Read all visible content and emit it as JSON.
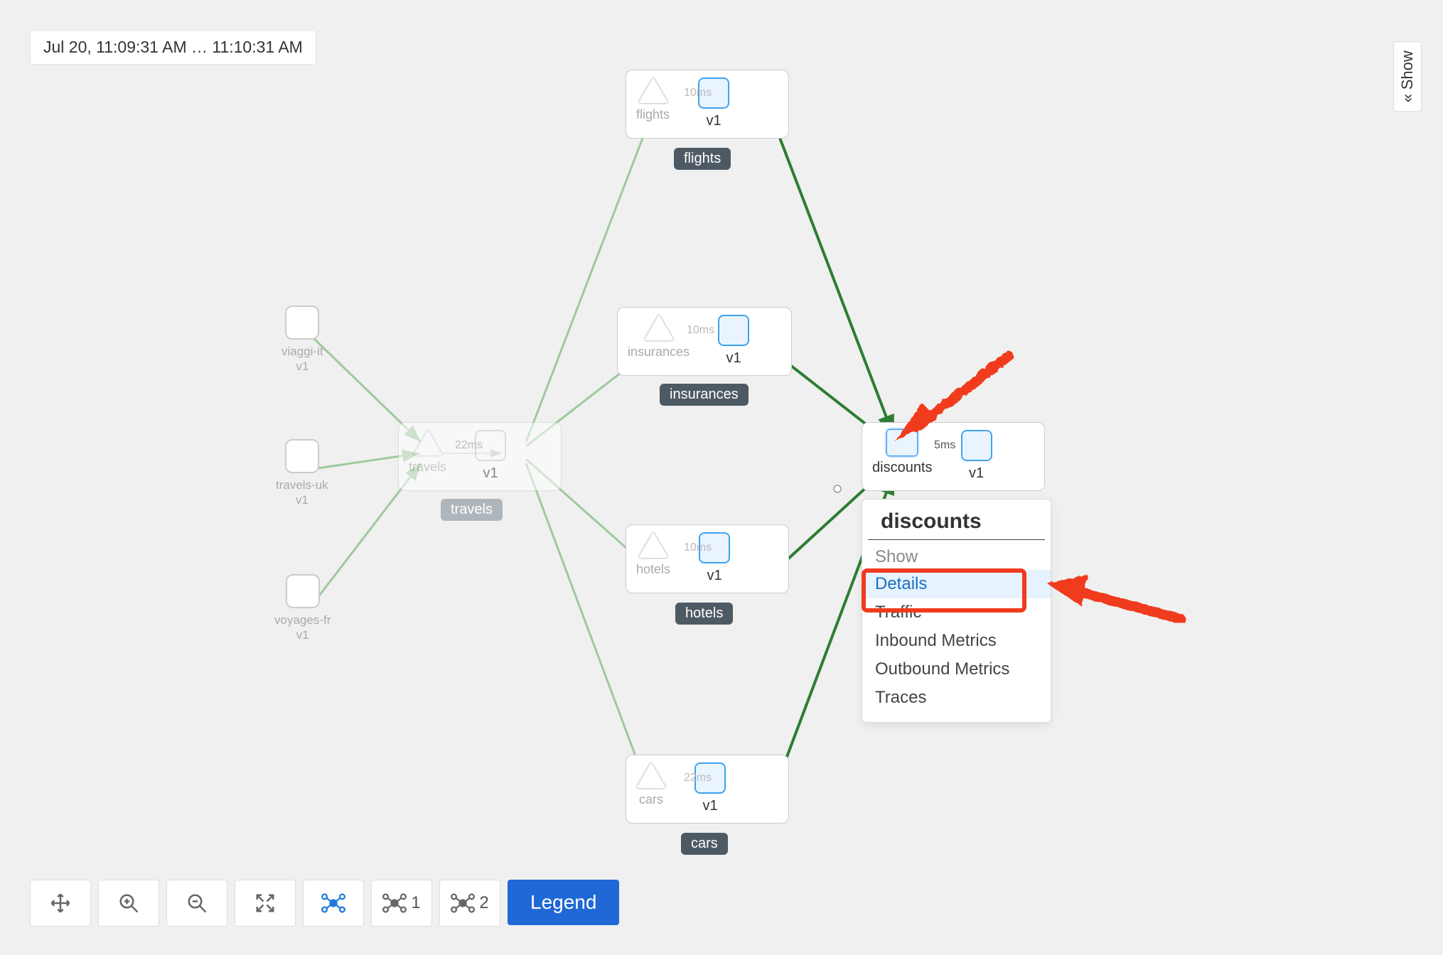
{
  "timestamp": "Jul 20, 11:09:31 AM … 11:10:31 AM",
  "show_panel_label": "Show",
  "legend_button": "Legend",
  "toolbar": {
    "layout1_suffix": "1",
    "layout2_suffix": "2"
  },
  "origins": [
    {
      "label": "viaggi-it\nv1"
    },
    {
      "label": "travels-uk\nv1"
    },
    {
      "label": "voyages-fr\nv1"
    }
  ],
  "travels": {
    "service": "travels",
    "version": "v1",
    "latency": "22ms",
    "group": "travels"
  },
  "services": [
    {
      "name": "flights",
      "version": "v1",
      "latency": "10ms",
      "group": "flights"
    },
    {
      "name": "insurances",
      "version": "v1",
      "latency": "10ms",
      "group": "insurances"
    },
    {
      "name": "hotels",
      "version": "v1",
      "latency": "10ms",
      "group": "hotels"
    },
    {
      "name": "cars",
      "version": "v1",
      "latency": "22ms",
      "group": "cars"
    }
  ],
  "discounts": {
    "service": "discounts",
    "version": "v1",
    "latency": "5ms"
  },
  "context_menu": {
    "title": "discounts",
    "subheading": "Show",
    "items": [
      "Details",
      "Traffic",
      "Inbound Metrics",
      "Outbound Metrics",
      "Traces"
    ],
    "hovered_index": 0
  }
}
